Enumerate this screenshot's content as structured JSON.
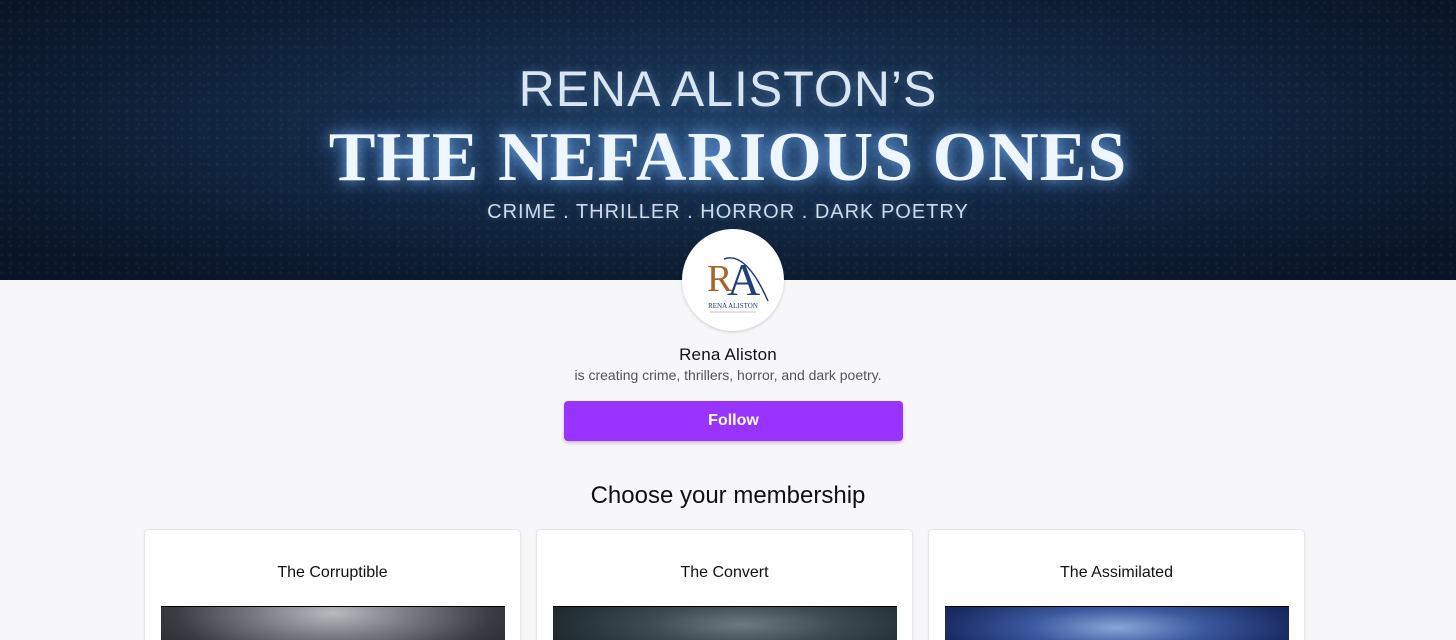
{
  "banner": {
    "line1": "RENA ALISTON’S",
    "line2": "THE NEFARIOUS ONES",
    "line3": "CRIME . THRILLER . HORROR . DARK POETRY"
  },
  "avatar": {
    "monogram": "RA",
    "logo_text": "RENA ALISTON",
    "colors": {
      "r": "#a6652c",
      "a": "#1f3e7a"
    }
  },
  "creator": {
    "name": "Rena Aliston",
    "tagline": "is creating crime, thrillers, horror, and dark poetry."
  },
  "follow_button": {
    "label": "Follow",
    "color": "#9933ff"
  },
  "membership": {
    "heading": "Choose your membership",
    "tiers": [
      {
        "name": "The Corruptible",
        "image": "hooded-figure-image"
      },
      {
        "name": "The Convert",
        "image": "dark-figure-image"
      },
      {
        "name": "The Assimilated",
        "image": "blue-masked-figure-image"
      }
    ]
  }
}
